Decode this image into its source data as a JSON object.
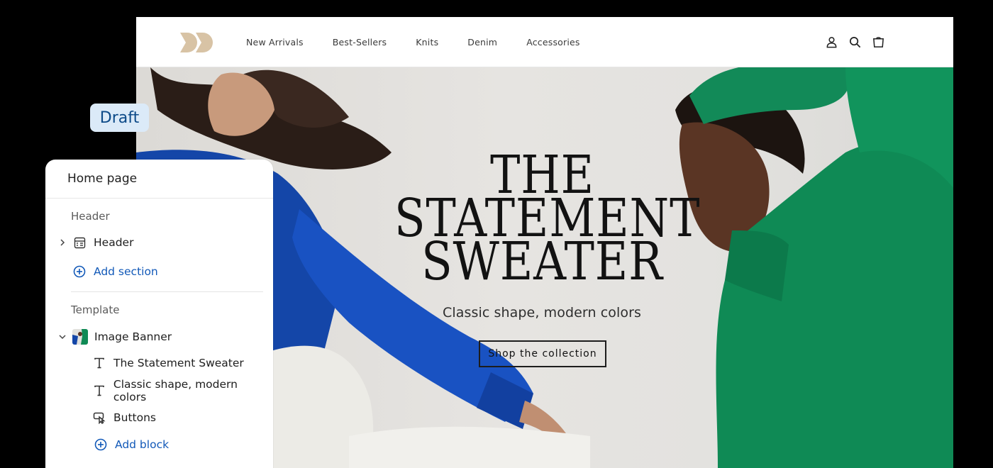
{
  "store": {
    "nav": {
      "links": [
        "New Arrivals",
        "Best-Sellers",
        "Knits",
        "Denim",
        "Accessories"
      ],
      "icons": [
        "account-icon",
        "search-icon",
        "cart-icon"
      ]
    },
    "hero": {
      "headline_lines": [
        "THE",
        "STATEMENT",
        "SWEATER"
      ],
      "subheading": "Classic shape, modern colors",
      "button_label": "Shop the collection"
    },
    "colors": {
      "logo": "#d8c3a5",
      "sweater_blue": "#1446a8",
      "sweater_green": "#0f8a55"
    }
  },
  "badge": {
    "label": "Draft"
  },
  "editor": {
    "title": "Home page",
    "header_group": {
      "label": "Header",
      "items": [
        {
          "label": "Header",
          "icon": "header-layout-icon"
        }
      ],
      "add_label": "Add section"
    },
    "template_group": {
      "label": "Template",
      "section": {
        "label": "Image Banner",
        "icon": "image-thumbnail"
      },
      "blocks": [
        {
          "label": "The Statement Sweater",
          "icon": "text-icon"
        },
        {
          "label": "Classic shape, modern colors",
          "icon": "text-icon"
        },
        {
          "label": "Buttons",
          "icon": "button-cursor-icon"
        }
      ],
      "add_label": "Add block"
    },
    "link_color": "#1259b8"
  }
}
